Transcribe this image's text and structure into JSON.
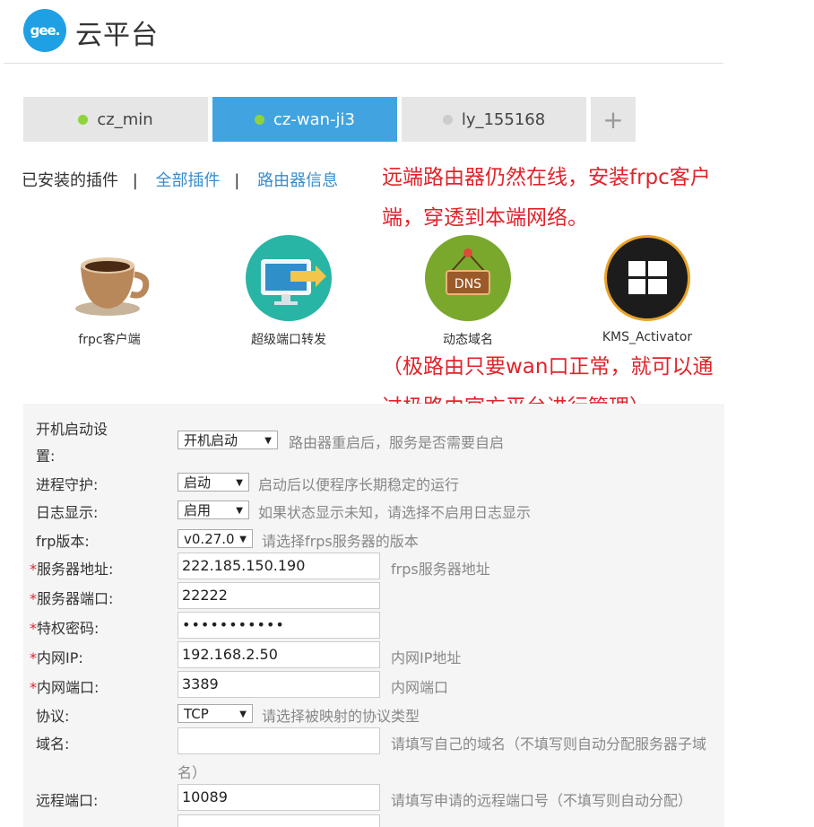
{
  "header": {
    "logo_text": "gee.",
    "platform_name": "云平台"
  },
  "tabs": [
    {
      "label": "cz_min",
      "status_color": "#8fd33b",
      "active": false
    },
    {
      "label": "cz-wan-ji3",
      "status_color": "#8fd33b",
      "active": true
    },
    {
      "label": "ly_155168",
      "status_color": "#cccccc",
      "active": false
    }
  ],
  "add_tab_label": "+",
  "plugin_nav": {
    "installed": "已安装的插件",
    "separator": "|",
    "all": "全部插件",
    "router_info": "路由器信息"
  },
  "annotations": {
    "line1": "远端路由器仍然在线，安装frpc客户",
    "line2": "端，穿透到本端网络。",
    "line3": "（极路由只要wan口正常，就可以通",
    "line4": "过极路由官方平台进行管理）"
  },
  "plugins": [
    {
      "label": "frpc客户端",
      "icon": "coffee-cup-icon"
    },
    {
      "label": "超级端口转发",
      "icon": "port-forward-monitor-icon"
    },
    {
      "label": "动态域名",
      "icon": "dns-sign-icon"
    },
    {
      "label": "KMS_Activator",
      "icon": "windows-logo-icon"
    }
  ],
  "form": {
    "boot": {
      "label_line1": "开机启动设",
      "label_line2": "置:",
      "value": "开机启动",
      "hint": "路由器重启后，服务是否需要自启"
    },
    "daemon": {
      "label": "进程守护:",
      "value": "启动",
      "hint": "启动后以便程序长期稳定的运行"
    },
    "log": {
      "label": "日志显示:",
      "value": "启用",
      "hint": "如果状态显示未知，请选择不启用日志显示"
    },
    "frp_version": {
      "label": "frp版本:",
      "value": "v0.27.0",
      "hint": "请选择frps服务器的版本"
    },
    "server_addr": {
      "required": "*",
      "label": "服务器地址:",
      "value": "222.185.150.190",
      "hint": "frps服务器地址"
    },
    "server_port": {
      "required": "*",
      "label": "服务器端口:",
      "value": "22222"
    },
    "token": {
      "required": "*",
      "label": "特权密码:",
      "value": "•••••••••••"
    },
    "local_ip": {
      "required": "*",
      "label": "内网IP:",
      "value": "192.168.2.50",
      "hint": "内网IP地址"
    },
    "local_port": {
      "required": "*",
      "label": "内网端口:",
      "value": "3389",
      "hint": "内网端口"
    },
    "protocol": {
      "label": "协议:",
      "value": "TCP",
      "hint": "请选择被映射的协议类型"
    },
    "domain": {
      "label": "域名:",
      "value": "",
      "hint_line1": "请填写自己的域名（不填写则自动分配服务器子域",
      "hint_line2": "名）"
    },
    "remote_port": {
      "label": "远程端口:",
      "value": "10089",
      "hint": "请填写申请的远程端口号（不填写则自动分配）"
    }
  }
}
